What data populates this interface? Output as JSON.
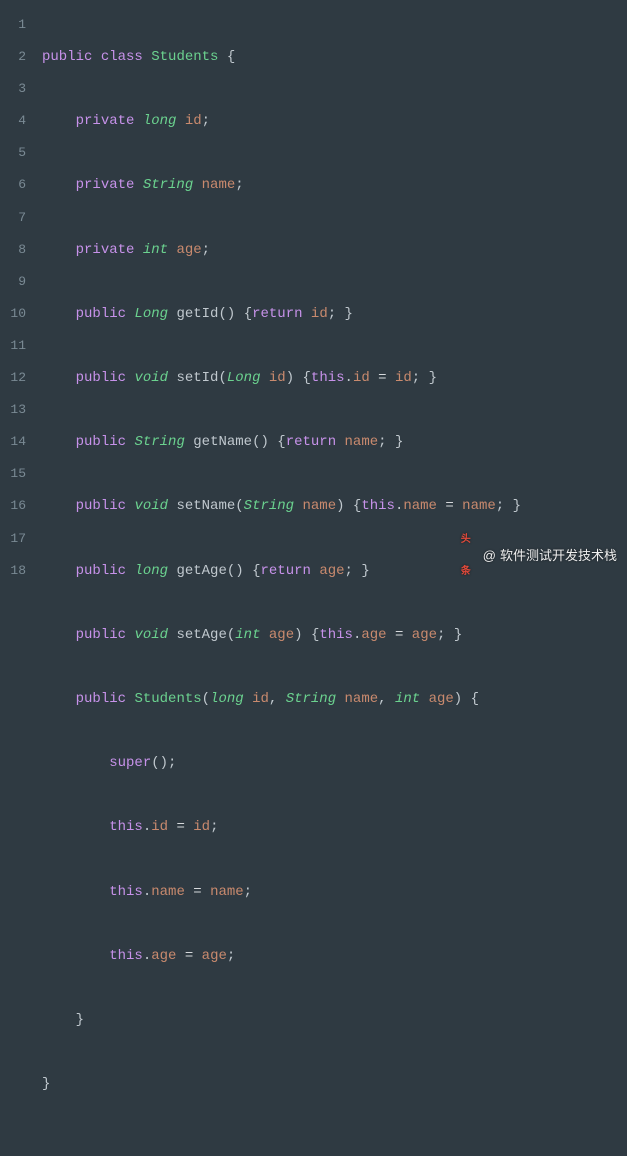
{
  "gutter": [
    "1",
    "2",
    "3",
    "4",
    "5",
    "6",
    "7",
    "8",
    "9",
    "10",
    "11",
    "12",
    "13",
    "14",
    "15",
    "16",
    "17",
    "18"
  ],
  "code": {
    "public": "public",
    "class": "class",
    "private": "private",
    "void": "void",
    "return": "return",
    "this": "this",
    "super": "super",
    "int": "int",
    "long": "long",
    "Long": "Long",
    "String": "String",
    "Students": "Students",
    "id": "id",
    "name": "name",
    "age": "age",
    "getId": "getId",
    "setId": "setId",
    "getName": "getName",
    "setName": "setName",
    "getAge": "getAge",
    "setAge": "setAge",
    "lbrace": "{",
    "rbrace": "}",
    "lparen": "(",
    "rparen": ")",
    "semi": ";",
    "comma": ",",
    "dot": ".",
    "eq": " = ",
    "sp": " ",
    "ind1": "    ",
    "ind2": "        ",
    "empty": ""
  },
  "watermark": {
    "logo": "头条",
    "at": "@",
    "text": "软件测试开发技术栈"
  }
}
